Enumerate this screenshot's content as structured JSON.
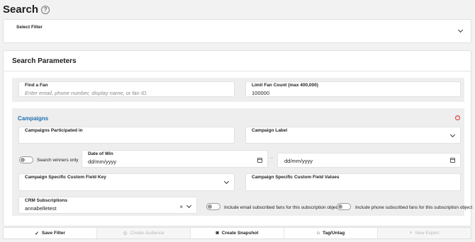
{
  "page": {
    "title": "Search",
    "help_icon": "?"
  },
  "filter": {
    "label": "Select Filter",
    "value": ""
  },
  "search_parameters": {
    "title": "Search Parameters",
    "find_fan": {
      "label": "Find a Fan",
      "placeholder": "Enter email, phone number, display name, or fan ID.",
      "value": ""
    },
    "limit": {
      "label": "Limit Fan Count (max 400,000)",
      "value": "100000"
    }
  },
  "campaigns": {
    "title": "Campaigns",
    "participated": {
      "label": "Campaigns Participated in",
      "value": ""
    },
    "campaign_label": {
      "label": "Campaign Label",
      "value": ""
    },
    "winners_only": {
      "label": "Search winners only",
      "checked": false
    },
    "date_of_win": {
      "label": "Date of Win",
      "from_placeholder": "dd/mm/yyyy",
      "to_placeholder": "dd/mm/yyyy",
      "separator": "~"
    },
    "custom_field_key": {
      "label": "Campaign Specific Custom Field Key",
      "value": ""
    },
    "custom_field_values": {
      "label": "Campaign Specific Custom Field Values",
      "value": ""
    }
  },
  "crm": {
    "label": "CRM Subscriptions",
    "value": "annabelletest",
    "clear_icon": "×",
    "email_toggle": {
      "label": "Include email subscribed fans for this subscription object",
      "checked": false
    },
    "phone_toggle": {
      "label": "Include phone subscribed fans for this subscription object",
      "checked": false
    }
  },
  "footer": {
    "save_filter": {
      "label": "Save Filter",
      "icon": "check-icon",
      "enabled": true
    },
    "create_audience": {
      "label": "Create Audience",
      "icon": "audience-icon",
      "enabled": false
    },
    "create_snapshot": {
      "label": "Create Snapshot",
      "icon": "camera-icon",
      "enabled": true
    },
    "tag_untag": {
      "label": "Tag/Untag",
      "icon": "tag-icon",
      "enabled": true
    },
    "new_export": {
      "label": "New Export",
      "icon": "export-icon",
      "enabled": false
    }
  }
}
